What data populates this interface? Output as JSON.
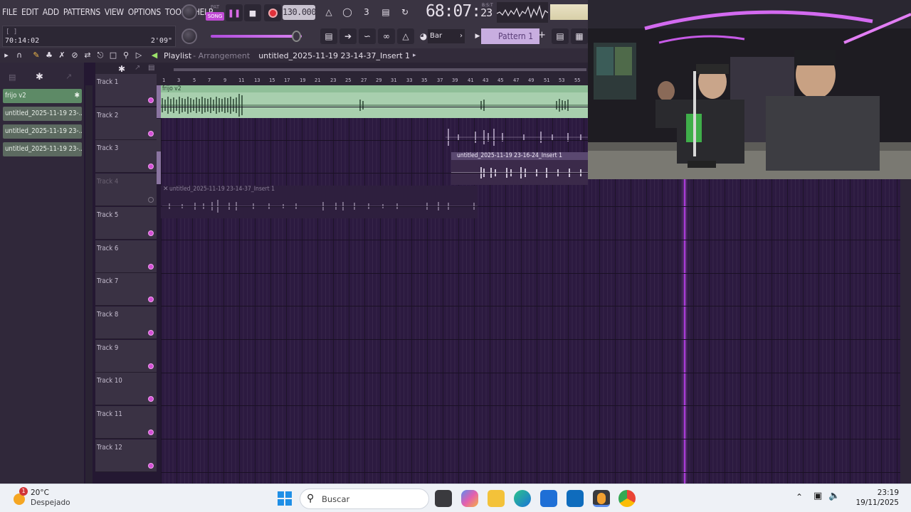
{
  "menu": [
    "FILE",
    "EDIT",
    "ADD",
    "PATTERNS",
    "VIEW",
    "OPTIONS",
    "TOOLS",
    "HELP"
  ],
  "hint_panel": {
    "bracket": "[ ]",
    "time": "70:14:02",
    "duration": "2'09\""
  },
  "transport": {
    "pat_label": "PAT",
    "song_label": "SONG",
    "tempo": "130.000",
    "clock_main": "68:07",
    "clock_frac": "23",
    "clock_unit": "B:S:T"
  },
  "toolbar2": {
    "snap": "Bar",
    "pattern": "Pattern 1",
    "pattern_add": "+"
  },
  "playlist": {
    "title": "Playlist",
    "subtitle": "- Arrangement",
    "breadcrumb": "untitled_2025-11-19 23-14-37_Insert 1"
  },
  "picker": {
    "items": [
      {
        "label": "frijo v2"
      },
      {
        "label": "untitled_2025-11-19 23-..."
      },
      {
        "label": "untitled_2025-11-19 23-..."
      },
      {
        "label": "untitled_2025-11-19 23-..."
      }
    ]
  },
  "ruler": {
    "bars": [
      "1",
      "3",
      "5",
      "7",
      "9",
      "11",
      "13",
      "15",
      "17",
      "19",
      "21",
      "23",
      "25",
      "27",
      "29",
      "31",
      "33",
      "35",
      "37",
      "39",
      "41",
      "43",
      "45",
      "47",
      "49",
      "51",
      "53",
      "55"
    ]
  },
  "tracks": [
    {
      "name": "Track 1",
      "muted": false
    },
    {
      "name": "Track 2",
      "muted": false
    },
    {
      "name": "Track 3",
      "muted": false
    },
    {
      "name": "Track 4",
      "muted": true
    },
    {
      "name": "Track 5",
      "muted": false
    },
    {
      "name": "Track 6",
      "muted": false
    },
    {
      "name": "Track 7",
      "muted": false
    },
    {
      "name": "Track 8",
      "muted": false
    },
    {
      "name": "Track 9",
      "muted": false
    },
    {
      "name": "Track 10",
      "muted": false
    },
    {
      "name": "Track 11",
      "muted": false
    },
    {
      "name": "Track 12",
      "muted": false
    }
  ],
  "clips": {
    "frijo": "frijo v2",
    "insert_track3": "untitled_2025-11-19 23-16-24_Insert 1",
    "insert_track4": "untitled_2025-11-19 23-14-37_Insert 1"
  },
  "taskbar": {
    "weather_temp": "20°C",
    "weather_desc": "Despejado",
    "weather_badge": "1",
    "search_placeholder": "Buscar",
    "time": "23:19",
    "date": "19/11/2025"
  },
  "colors": {
    "accent": "#c04ad4",
    "clip_audio": "#a8cfae",
    "grid_bg": "#2c1a40",
    "playhead": "#a83ad6"
  }
}
